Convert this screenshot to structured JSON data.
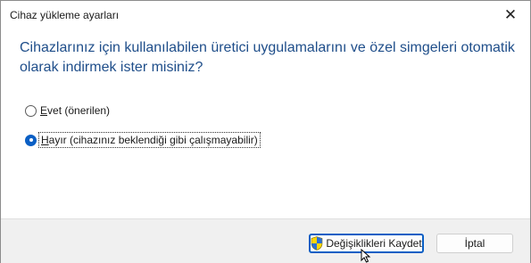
{
  "window": {
    "title": "Cihaz yükleme ayarları",
    "close_glyph": "✕"
  },
  "question": "Cihazlarınız için kullanılabilen üretici uygulamalarını ve özel simgeleri otomatik olarak indirmek ister misiniz?",
  "options": [
    {
      "accel": "E",
      "rest": "vet (önerilen)",
      "checked": false
    },
    {
      "accel": "H",
      "rest": "ayır (cihazınız beklendiği gibi çalışmayabilir)",
      "checked": true
    }
  ],
  "buttons": {
    "save_label": "Değişiklikleri Kaydet",
    "cancel_label": "İptal"
  },
  "icons": {
    "save_icon": "uac-shield-icon",
    "cursor": "mouse-pointer-icon"
  },
  "colors": {
    "accent": "#0a5fc4",
    "question_text": "#1f4e8a",
    "footer_bg": "#f0f0f0"
  }
}
